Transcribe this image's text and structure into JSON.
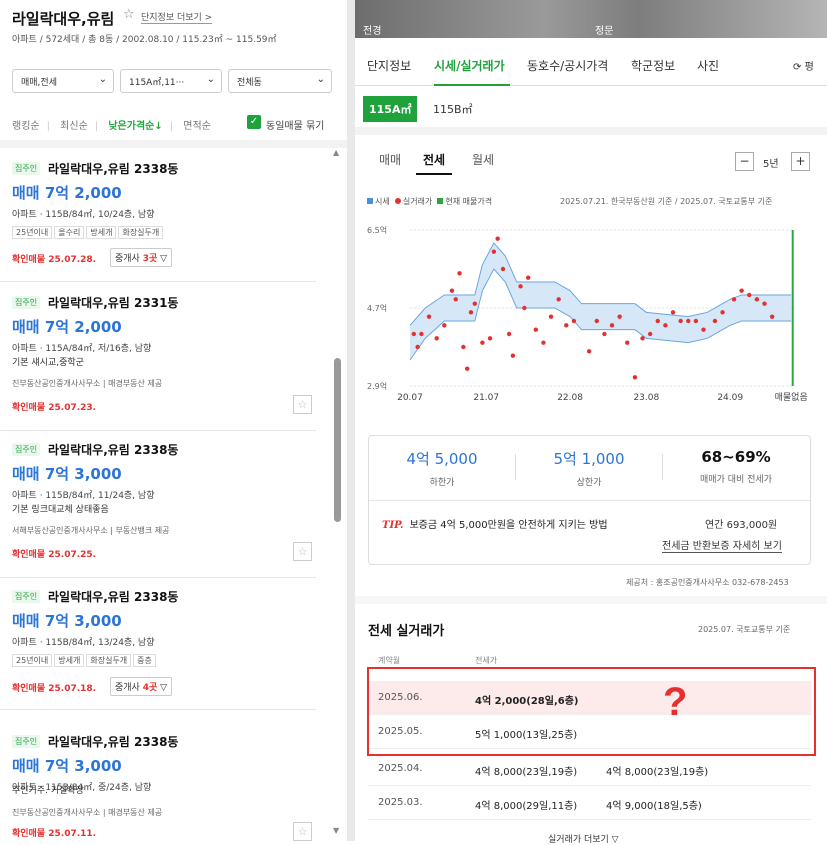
{
  "left": {
    "title": "라일락대우,유림",
    "detail_link": "단지정보 더보기 >",
    "subinfo": "아파트 / 572세대 / 총 8동 / 2002.08.10 / 115.23㎡ ~ 115.59㎡",
    "filters": [
      {
        "label": "매매,전세"
      },
      {
        "label": "115A㎡,11···"
      },
      {
        "label": "전체동"
      }
    ],
    "sort": {
      "items": [
        "랭킹순",
        "최신순",
        "낮은가격순↓",
        "면적순"
      ],
      "active_index": 2
    },
    "same_item_toggle": {
      "label": "동일매물 묶기",
      "checked": true
    },
    "listings": [
      {
        "badge": "집주인",
        "name": "라일락대우,유림 2338동",
        "price": "매매 7억 2,000",
        "detail": "아파트 · 115B/84㎡, 10/24층, 남향",
        "desc": "",
        "tags": [
          "25년이내",
          "올수리",
          "방세개",
          "화장실두개"
        ],
        "agency": "",
        "confirmed": "확인매물 25.07.28.",
        "agents": {
          "prefix": "중개사 ",
          "count": "3곳",
          "suffix": " ▽"
        }
      },
      {
        "badge": "집주인",
        "name": "라일락대우,유림 2331동",
        "price": "매매 7억 2,000",
        "detail": "아파트 · 115A/84㎡, 저/16층, 남향",
        "desc": "기본 섀시교,중학군",
        "tags": [],
        "agency": "진부동산공인중개사사무소 | 매경부동산 제공",
        "confirmed": "확인매물 25.07.23.",
        "agents": null
      },
      {
        "badge": "집주인",
        "name": "라일락대우,유림 2338동",
        "price": "매매 7억 3,000",
        "detail": "아파트 · 115B/84㎡, 11/24층, 남향",
        "desc": "기본 링크대교체 상태좋음",
        "tags": [],
        "agency": "서해부동산공인중개사사무소 | 부동산뱅크 제공",
        "confirmed": "확인매물 25.07.25.",
        "agents": null
      },
      {
        "badge": "집주인",
        "name": "라일락대우,유림 2338동",
        "price": "매매 7억 3,000",
        "detail": "아파트 · 115B/84㎡, 13/24층, 남향",
        "desc": "",
        "tags": [
          "25년이내",
          "방세개",
          "화장실두개",
          "중층"
        ],
        "agency": "",
        "confirmed": "확인매물 25.07.18.",
        "agents": {
          "prefix": "중개사 ",
          "count": "4곳",
          "suffix": " ▽"
        }
      },
      {
        "badge": "집주인",
        "name": "라일락대우,유림 2338동",
        "price": "매매 7억 3,000",
        "detail": "아파트 · 115B/84㎡, 중/24층, 남향",
        "desc": "주인거주. 거실확장",
        "tags": [],
        "agency": "진부동산공인중개사사무소 | 매경부동산 제공",
        "confirmed": "확인매물 25.07.11.",
        "agents": null
      }
    ]
  },
  "right": {
    "photo_labels": [
      "전경",
      "정문"
    ],
    "tabs": [
      "단지정보",
      "시세/실거래가",
      "동호수/공시가격",
      "학군정보",
      "사진"
    ],
    "active_tab": 1,
    "refresh_label": "평",
    "areas": [
      "115A㎡",
      "115B㎡"
    ],
    "chart_tabs": [
      "매매",
      "전세",
      "월세"
    ],
    "chart_tab_active": 1,
    "year_minus": "−",
    "year_label": "5년",
    "year_plus": "+",
    "legend": [
      {
        "label": "시세",
        "color": "#4a90d9"
      },
      {
        "label": "실거래가",
        "color": "#e4312f"
      },
      {
        "label": "현재 매물가격",
        "color": "#2aa645"
      }
    ],
    "source_note": "2025.07.21. 한국부동산원 기준 / 2025.07. 국토교통부 기준",
    "stats": [
      {
        "value": "4억 5,000",
        "label": "하한가"
      },
      {
        "value": "5억 1,000",
        "label": "상한가"
      },
      {
        "value": "68~69%",
        "label": "매매가 대비 전세가"
      }
    ],
    "tip": {
      "badge": "TIP.",
      "text": "보증금 4억 5,000만원을 안전하게 지키는 방법",
      "right": "연간 693,000원",
      "link": "전세금 반환보증 자세히 보기"
    },
    "provider": "제공처 : 홍조공인중개사사무소 032-678-2453",
    "section_title": "전세 실거래가",
    "section_note": "2025.07. 국토교통부 기준",
    "table_headers": [
      "계약월",
      "전세가"
    ],
    "rows": [
      {
        "date": "2025.06.",
        "price": "4억 2,000(28일,6층)",
        "price2": ""
      },
      {
        "date": "2025.05.",
        "price": "5억 1,000(13일,25층)",
        "price2": ""
      },
      {
        "date": "2025.04.",
        "price": "4억 8,000(23일,19층)",
        "price2": "4억 8,000(23일,19층)"
      },
      {
        "date": "2025.03.",
        "price": "4억 8,000(29일,11층)",
        "price2": "4억 9,000(18일,5층)"
      }
    ],
    "question_mark": "?",
    "more_button": "실거래가 더보기 ▽"
  },
  "chart_data": {
    "type": "line",
    "yticks": [
      "6.5억",
      "4.7억",
      "2.9억"
    ],
    "ytick_values": [
      6.5,
      4.7,
      2.9
    ],
    "ylim": [
      2.9,
      6.5
    ],
    "xticks": [
      "20.07",
      "21.07",
      "22.08",
      "23.08",
      "24.09",
      "매물없음"
    ],
    "xtick_values": [
      2020.5,
      2021.5,
      2022.6,
      2023.6,
      2024.7,
      2025.5
    ],
    "xlim": [
      2020.5,
      2025.55
    ],
    "series": [
      {
        "name": "시세",
        "upper": [
          [
            2020.5,
            4.3
          ],
          [
            2020.7,
            4.7
          ],
          [
            2020.95,
            5.0
          ],
          [
            2021.35,
            5.0
          ],
          [
            2021.45,
            5.7
          ],
          [
            2021.6,
            6.2
          ],
          [
            2021.75,
            5.9
          ],
          [
            2021.9,
            5.3
          ],
          [
            2022.4,
            5.3
          ],
          [
            2022.6,
            5.1
          ],
          [
            2022.75,
            4.8
          ],
          [
            2023.45,
            4.8
          ],
          [
            2023.6,
            4.6
          ],
          [
            2024.15,
            4.5
          ],
          [
            2024.4,
            4.6
          ],
          [
            2024.7,
            4.9
          ],
          [
            2024.85,
            5.0
          ],
          [
            2025.5,
            5.0
          ]
        ],
        "lower": [
          [
            2020.5,
            3.5
          ],
          [
            2020.7,
            4.0
          ],
          [
            2020.95,
            4.4
          ],
          [
            2021.35,
            4.4
          ],
          [
            2021.45,
            5.1
          ],
          [
            2021.6,
            5.6
          ],
          [
            2021.75,
            5.3
          ],
          [
            2021.9,
            4.7
          ],
          [
            2022.4,
            4.7
          ],
          [
            2022.6,
            4.5
          ],
          [
            2022.75,
            4.2
          ],
          [
            2023.45,
            4.2
          ],
          [
            2023.6,
            4.0
          ],
          [
            2024.15,
            3.9
          ],
          [
            2024.4,
            4.0
          ],
          [
            2024.7,
            4.3
          ],
          [
            2024.85,
            4.4
          ],
          [
            2025.5,
            4.4
          ]
        ]
      },
      {
        "name": "실거래가",
        "points": [
          [
            2020.55,
            4.1
          ],
          [
            2020.6,
            3.8
          ],
          [
            2020.65,
            4.1
          ],
          [
            2020.75,
            4.5
          ],
          [
            2020.85,
            4.0
          ],
          [
            2020.95,
            4.3
          ],
          [
            2021.05,
            5.1
          ],
          [
            2021.1,
            4.9
          ],
          [
            2021.15,
            5.5
          ],
          [
            2021.2,
            3.8
          ],
          [
            2021.25,
            3.3
          ],
          [
            2021.3,
            4.6
          ],
          [
            2021.35,
            4.8
          ],
          [
            2021.45,
            3.9
          ],
          [
            2021.55,
            4.0
          ],
          [
            2021.6,
            6.0
          ],
          [
            2021.65,
            6.3
          ],
          [
            2021.72,
            5.6
          ],
          [
            2021.8,
            4.1
          ],
          [
            2021.85,
            3.6
          ],
          [
            2021.95,
            5.2
          ],
          [
            2022.0,
            4.7
          ],
          [
            2022.05,
            5.4
          ],
          [
            2022.15,
            4.2
          ],
          [
            2022.25,
            3.9
          ],
          [
            2022.35,
            4.5
          ],
          [
            2022.45,
            4.9
          ],
          [
            2022.55,
            4.3
          ],
          [
            2022.65,
            4.4
          ],
          [
            2022.85,
            3.7
          ],
          [
            2022.95,
            4.4
          ],
          [
            2023.05,
            4.1
          ],
          [
            2023.15,
            4.3
          ],
          [
            2023.25,
            4.5
          ],
          [
            2023.35,
            3.9
          ],
          [
            2023.45,
            3.1
          ],
          [
            2023.55,
            4.0
          ],
          [
            2023.65,
            4.1
          ],
          [
            2023.75,
            4.4
          ],
          [
            2023.85,
            4.3
          ],
          [
            2023.95,
            4.6
          ],
          [
            2024.05,
            4.4
          ],
          [
            2024.15,
            4.4
          ],
          [
            2024.25,
            4.4
          ],
          [
            2024.35,
            4.2
          ],
          [
            2024.5,
            4.4
          ],
          [
            2024.6,
            4.6
          ],
          [
            2024.75,
            4.9
          ],
          [
            2024.85,
            5.1
          ],
          [
            2024.95,
            5.0
          ],
          [
            2025.05,
            4.9
          ],
          [
            2025.15,
            4.8
          ],
          [
            2025.25,
            4.5
          ]
        ]
      },
      {
        "name": "현재 매물가격",
        "x": 2025.52
      }
    ]
  }
}
